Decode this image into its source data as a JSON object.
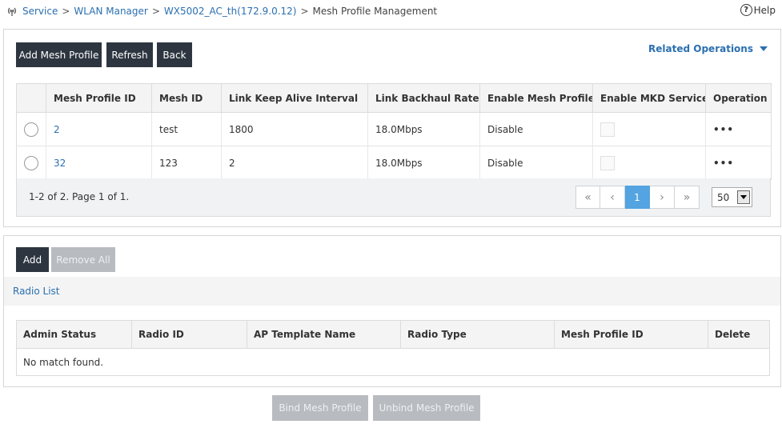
{
  "breadcrumb": {
    "items": [
      "Service",
      "WLAN Manager",
      "WX5002_AC_th(172.9.0.12)"
    ],
    "separator": ">",
    "current": "Mesh Profile Management"
  },
  "help_label": "Help",
  "toolbar": {
    "add_mesh_profile": "Add Mesh Profile",
    "refresh": "Refresh",
    "back": "Back",
    "related_operations": "Related Operations"
  },
  "mesh_table": {
    "headers": [
      "Mesh Profile ID",
      "Mesh ID",
      "Link Keep Alive Interval",
      "Link Backhaul Rate",
      "Enable Mesh Profile",
      "Enable MKD Service",
      "Operation"
    ],
    "rows": [
      {
        "profile_id": "2",
        "mesh_id": "test",
        "keep_alive": "1800",
        "backhaul_rate": "18.0Mbps",
        "enable_profile": "Disable",
        "operation": "•••"
      },
      {
        "profile_id": "32",
        "mesh_id": "123",
        "keep_alive": "2",
        "backhaul_rate": "18.0Mbps",
        "enable_profile": "Disable",
        "operation": "•••"
      }
    ]
  },
  "pagination": {
    "info": "1-2 of 2. Page 1 of 1.",
    "first": "«",
    "prev": "‹",
    "current_page": "1",
    "next": "›",
    "last": "»",
    "page_size": "50"
  },
  "radio_section": {
    "add": "Add",
    "remove_all": "Remove All",
    "title": "Radio List",
    "headers": [
      "Admin Status",
      "Radio ID",
      "AP Template Name",
      "Radio Type",
      "Mesh Profile ID",
      "Delete"
    ],
    "empty_message": "No match found."
  },
  "footer": {
    "bind": "Bind Mesh Profile",
    "unbind": "Unbind Mesh Profile"
  },
  "colors": {
    "link": "#2a6fb0",
    "dark_button": "#2d3640",
    "disabled_button": "#b8bcc0",
    "active_page": "#53a4e0"
  }
}
